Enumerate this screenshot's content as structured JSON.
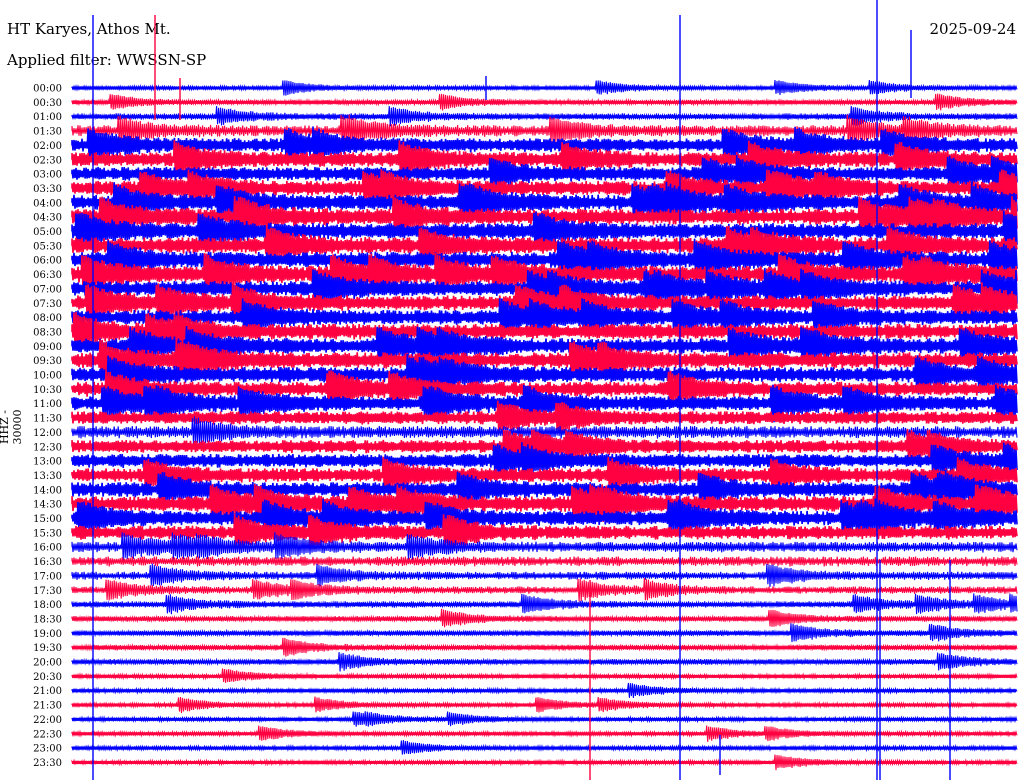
{
  "header": {
    "station": "HT Karyes, Athos Mt.",
    "filter": "Applied filter: WWSSN-SP",
    "date": "2025-09-24"
  },
  "chart_data": {
    "type": "line",
    "title": "HT Karyes, Athos Mt.",
    "subtitle": "Applied filter: WWSSN-SP",
    "date": "2025-09-24",
    "ylabel": "HHZ - 30000",
    "xlabel": "",
    "rows": [
      "00:00",
      "00:30",
      "01:00",
      "01:30",
      "02:00",
      "02:30",
      "03:00",
      "03:30",
      "04:00",
      "04:30",
      "05:00",
      "05:30",
      "06:00",
      "06:30",
      "07:00",
      "07:30",
      "08:00",
      "08:30",
      "09:00",
      "09:30",
      "10:00",
      "10:30",
      "11:00",
      "11:30",
      "12:00",
      "12:30",
      "13:00",
      "13:30",
      "14:00",
      "14:30",
      "15:00",
      "15:30",
      "16:00",
      "16:30",
      "17:00",
      "17:30",
      "18:00",
      "18:30",
      "19:00",
      "19:30",
      "20:00",
      "20:30",
      "21:00",
      "21:30",
      "22:00",
      "22:30",
      "23:00",
      "23:30"
    ],
    "colors": [
      "#0000ff",
      "#ff0040"
    ],
    "activity": [
      0.1,
      0.15,
      0.25,
      0.55,
      0.7,
      0.75,
      0.7,
      0.75,
      0.8,
      0.85,
      0.85,
      0.85,
      0.85,
      0.85,
      0.8,
      0.8,
      0.75,
      0.8,
      0.8,
      0.85,
      0.8,
      0.75,
      0.75,
      0.65,
      0.6,
      0.65,
      0.7,
      0.7,
      0.75,
      0.8,
      0.75,
      0.7,
      0.5,
      0.45,
      0.35,
      0.3,
      0.25,
      0.2,
      0.2,
      0.2,
      0.2,
      0.1,
      0.1,
      0.1,
      0.1,
      0.1,
      0.1,
      0.1
    ]
  }
}
